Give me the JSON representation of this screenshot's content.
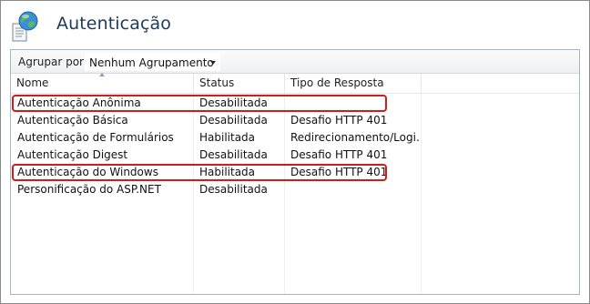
{
  "header": {
    "title": "Autenticação",
    "icon": "globe-document-icon"
  },
  "toolbar": {
    "group_by_label": "Agrupar por:",
    "group_by_value": "Nenhum Agrupamento"
  },
  "columns": {
    "name": "Nome",
    "status": "Status",
    "response_type": "Tipo de Resposta"
  },
  "rows": [
    {
      "name": "Autenticação Anônima",
      "status": "Desabilitada",
      "response": ""
    },
    {
      "name": "Autenticação Básica",
      "status": "Desabilitada",
      "response": "Desafio HTTP 401"
    },
    {
      "name": "Autenticação de Formulários",
      "status": "Habilitada",
      "response": "Redirecionamento/Logi..."
    },
    {
      "name": "Autenticação Digest",
      "status": "Desabilitada",
      "response": "Desafio HTTP 401"
    },
    {
      "name": "Autenticação do Windows",
      "status": "Habilitada",
      "response": "Desafio HTTP 401"
    },
    {
      "name": "Personificação do ASP.NET",
      "status": "Desabilitada",
      "response": ""
    }
  ],
  "highlight_color": "#d01c1c"
}
